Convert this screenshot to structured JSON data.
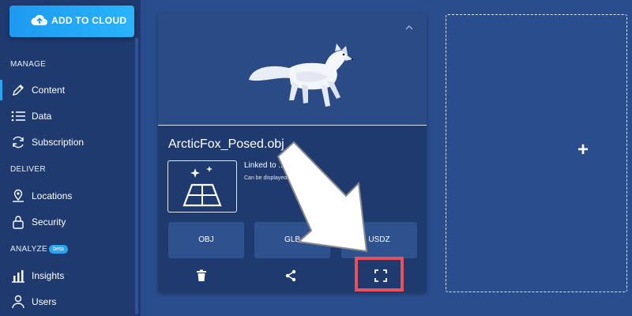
{
  "sidebar": {
    "add_button": "ADD TO CLOUD",
    "sections": {
      "manage": "MANAGE",
      "deliver": "DELIVER",
      "analyze": "ANALYZE",
      "analyze_badge": "beta"
    },
    "items": [
      {
        "label": "Content",
        "icon": "pencil-icon",
        "active": true
      },
      {
        "label": "Data",
        "icon": "list-icon"
      },
      {
        "label": "Subscription",
        "icon": "refresh-icon"
      },
      {
        "label": "Locations",
        "icon": "map-pin-icon"
      },
      {
        "label": "Security",
        "icon": "lock-icon"
      },
      {
        "label": "Insights",
        "icon": "bar-chart-icon"
      },
      {
        "label": "Users",
        "icon": "user-icon"
      }
    ]
  },
  "card": {
    "title": "ArcticFox_Posed.obj",
    "ar_title": "Linked to ... surface",
    "ar_description": "Can be displayed ... e surface.",
    "formats": [
      "OBJ",
      "GLB",
      "USDZ"
    ],
    "actions": [
      "trash-icon",
      "share-icon",
      "fullscreen-icon"
    ]
  },
  "colors": {
    "background": "#2a4d8d",
    "sidebar": "#1f3a6f",
    "accent": "#28b4fb",
    "highlight": "#e8505b"
  }
}
